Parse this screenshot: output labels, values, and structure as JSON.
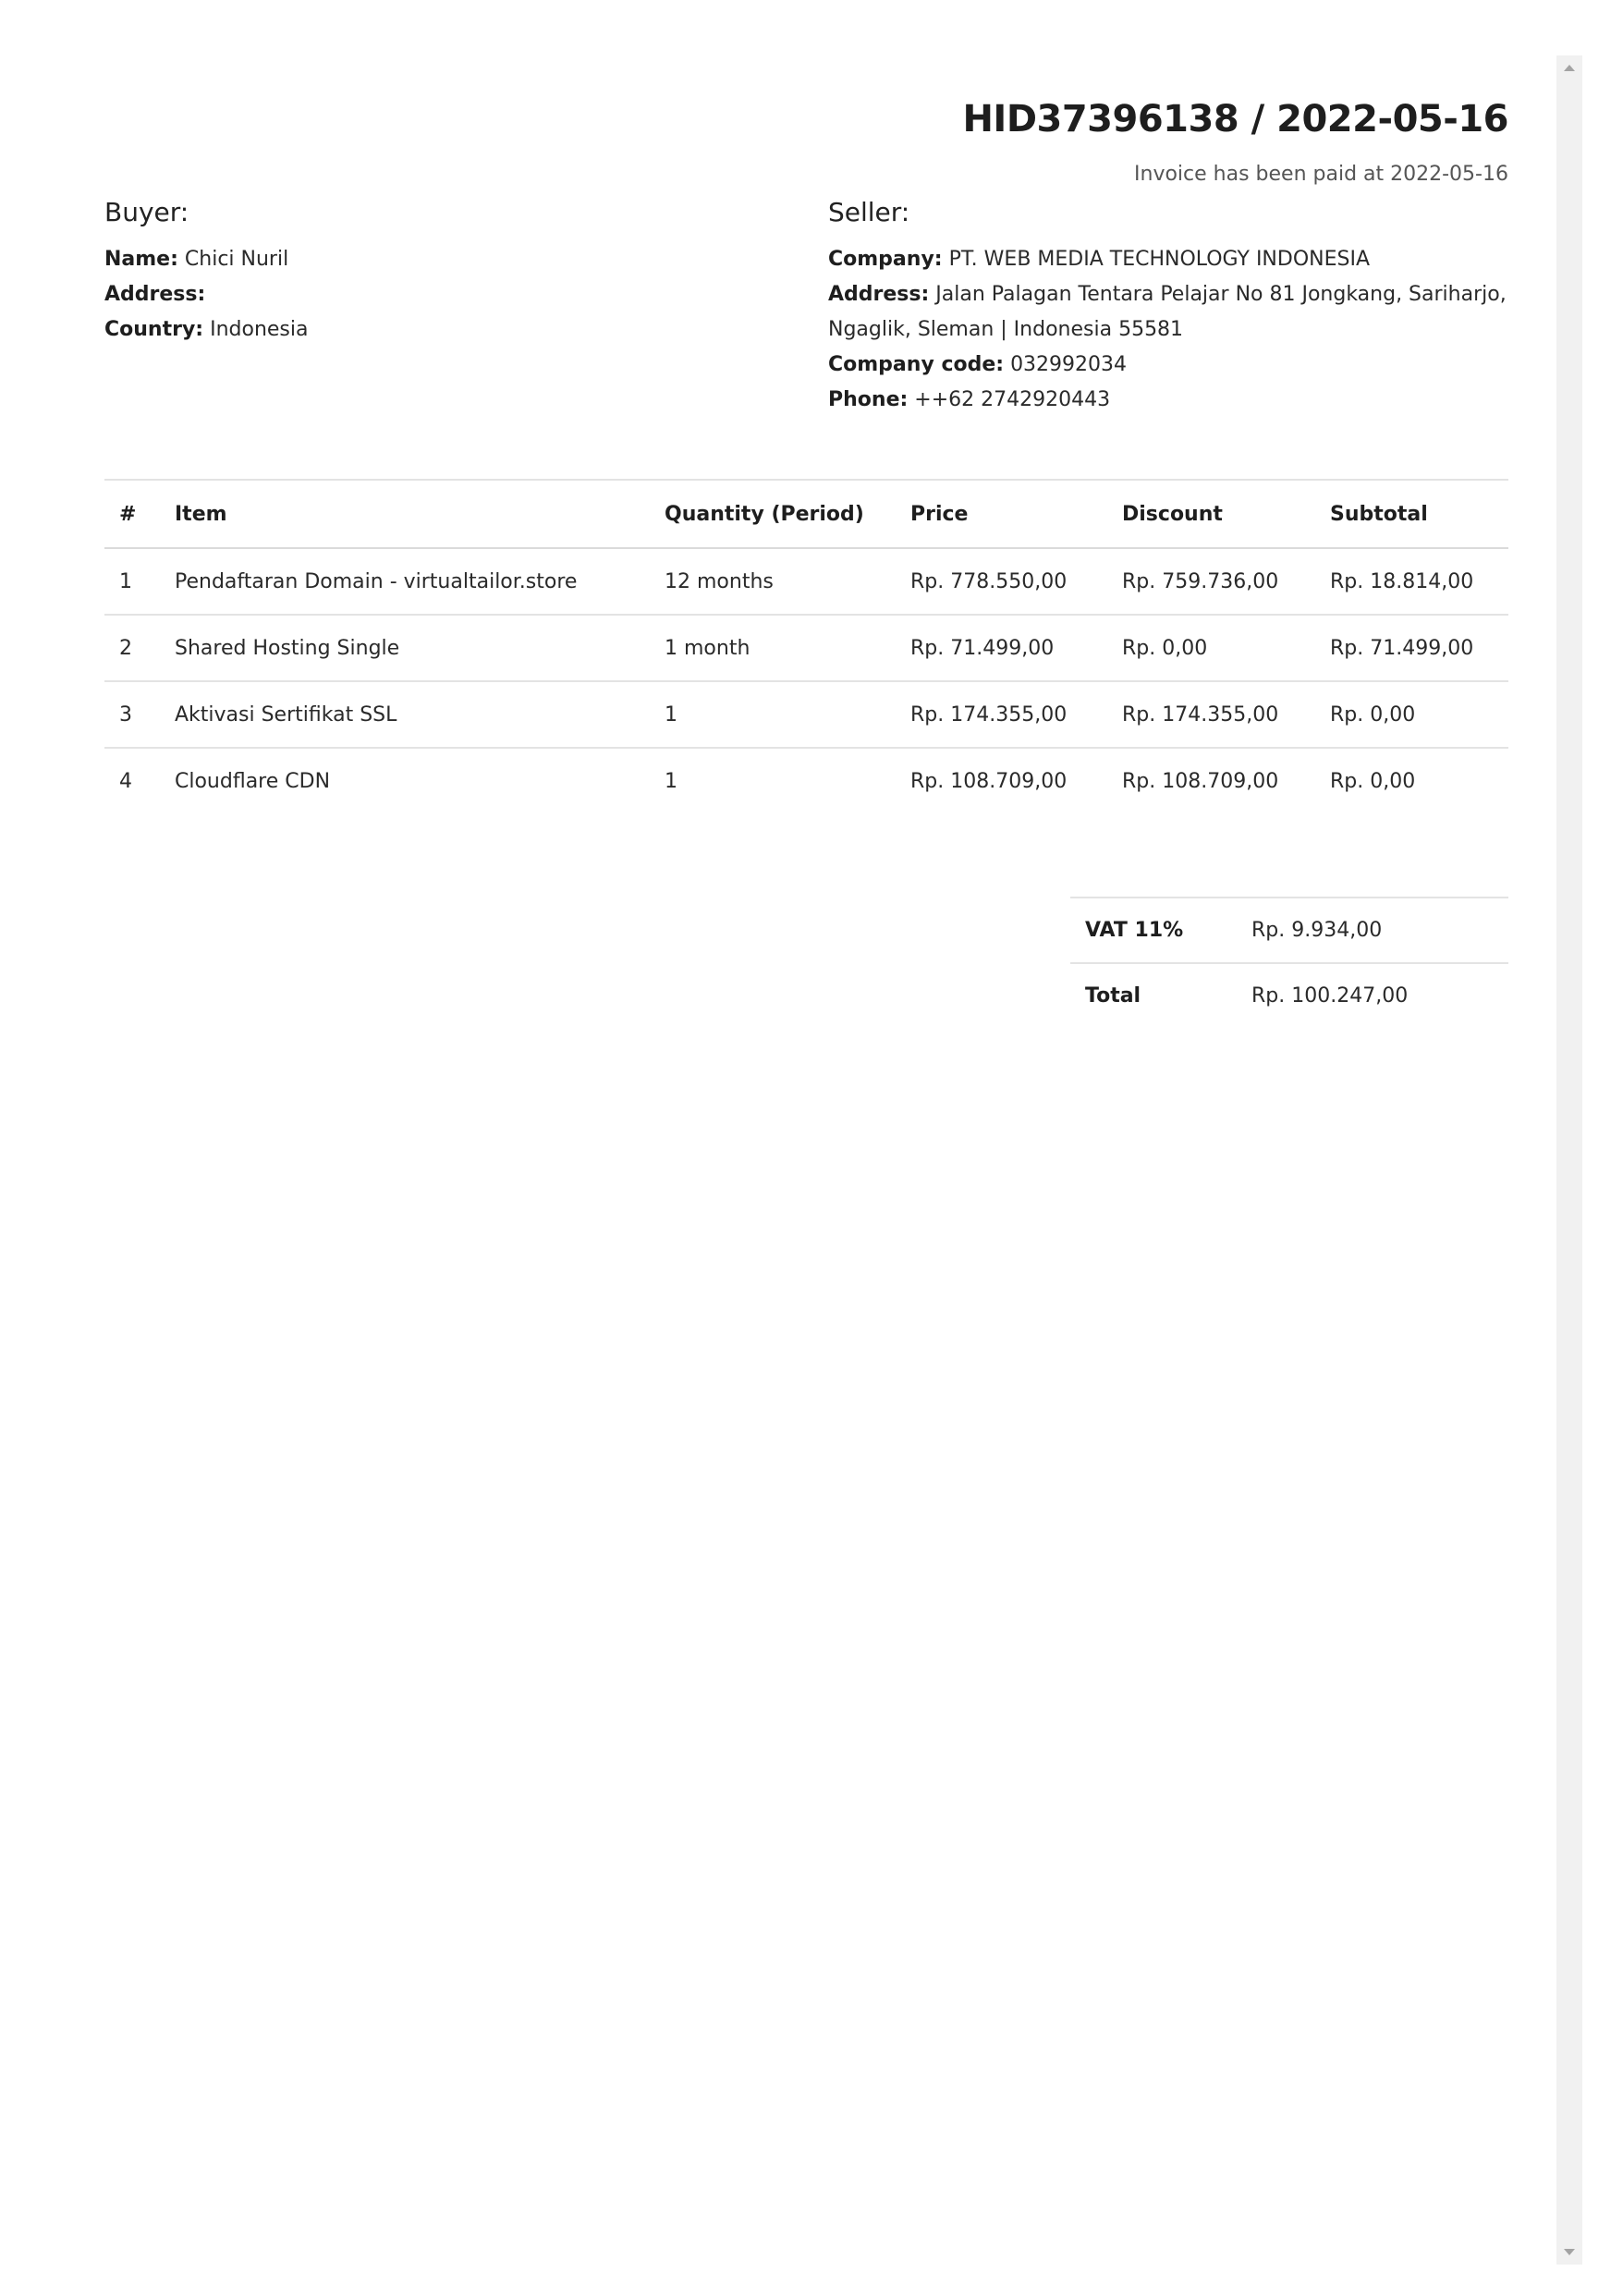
{
  "invoice": {
    "title": "HID37396138 / 2022-05-16",
    "paid_note": "Invoice has been paid at 2022-05-16"
  },
  "buyer": {
    "heading": "Buyer:",
    "name_label": "Name:",
    "name": "Chici Nuril",
    "address_label": "Address:",
    "address": "",
    "country_label": "Country:",
    "country": "Indonesia"
  },
  "seller": {
    "heading": "Seller:",
    "company_label": "Company:",
    "company": "PT. WEB MEDIA TECHNOLOGY INDONESIA",
    "address_label": "Address:",
    "address": "Jalan Palagan Tentara Pelajar No 81 Jongkang, Sariharjo, Ngaglik, Sleman | Indonesia 55581",
    "company_code_label": "Company code:",
    "company_code": "032992034",
    "phone_label": "Phone:",
    "phone": "++62 2742920443"
  },
  "items_table": {
    "headers": [
      "#",
      "Item",
      "Quantity (Period)",
      "Price",
      "Discount",
      "Subtotal"
    ],
    "rows": [
      [
        "1",
        "Pendaftaran Domain - virtualtailor.store",
        "12 months",
        "Rp. 778.550,00",
        "Rp. 759.736,00",
        "Rp. 18.814,00"
      ],
      [
        "2",
        "Shared Hosting Single",
        "1 month",
        "Rp. 71.499,00",
        "Rp. 0,00",
        "Rp. 71.499,00"
      ],
      [
        "3",
        "Aktivasi Sertifikat SSL",
        "1",
        "Rp. 174.355,00",
        "Rp. 174.355,00",
        "Rp. 0,00"
      ],
      [
        "4",
        "Cloudflare CDN",
        "1",
        "Rp. 108.709,00",
        "Rp. 108.709,00",
        "Rp. 0,00"
      ]
    ]
  },
  "totals": {
    "vat_label": "VAT 11%",
    "vat_value": "Rp. 9.934,00",
    "total_label": "Total",
    "total_value": "Rp. 100.247,00"
  }
}
